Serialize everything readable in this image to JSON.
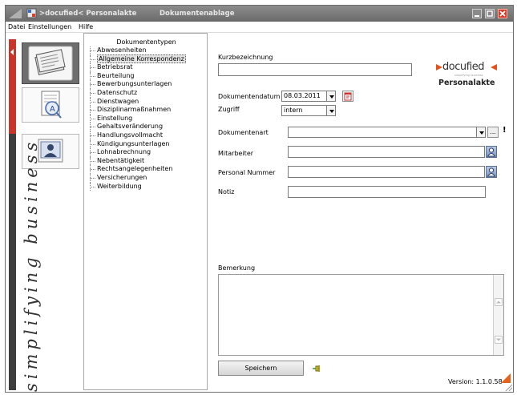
{
  "window": {
    "title": ">docufied< Personalakte",
    "subtitle": "Dokumentenablage"
  },
  "menu": [
    {
      "label": "Datei",
      "accel": "D"
    },
    {
      "label": "Einstellungen",
      "accel": "E"
    },
    {
      "label": "Hilfe",
      "accel": "H"
    }
  ],
  "left_nav": {
    "items": [
      {
        "name": "documents",
        "icon": "stack-of-documents-icon",
        "active": true
      },
      {
        "name": "search",
        "icon": "magnifier-document-icon",
        "active": false
      },
      {
        "name": "personnel",
        "icon": "person-card-icon",
        "active": false
      }
    ],
    "slogan": "simplifying business",
    "accent_color": "#c8362a"
  },
  "types_panel": {
    "header": "Dokumententypen",
    "items": [
      "Abwesenheiten",
      "Allgemeine Korrespondenz",
      "Betriebsrat",
      "Beurteilung",
      "Bewerbungsunterlagen",
      "Datenschutz",
      "Dienstwagen",
      "Disziplinarmaßnahmen",
      "Einstellung",
      "Gehaltsveränderung",
      "Handlungsvollmacht",
      "Kündigungsunterlagen",
      "Lohnabrechnung",
      "Nebentätigkeit",
      "Rechtsangelegenheiten",
      "Versicherungen",
      "Weiterbildung"
    ],
    "selected": "Allgemeine Korrespondenz"
  },
  "form": {
    "kurzbezeichnung_label": "Kurzbezeichnung",
    "kurzbezeichnung_value": "",
    "dokumentendatum_label": "Dokumentendatum",
    "dokumentendatum_value": "08.03.2011",
    "zugriff_label": "Zugriff",
    "zugriff_value": "intern",
    "dokumentenart_label": "Dokumentenart",
    "dokumentenart_value": "",
    "dokumentenart_required_mark": "!",
    "browse_button_label": "...",
    "mitarbeiter_label": "Mitarbeiter",
    "mitarbeiter_value": "",
    "personal_nummer_label": "Personal Nummer",
    "personal_nummer_value": "",
    "notiz_label": "Notiz",
    "notiz_value": "",
    "bemerkung_label": "Bemerkung",
    "bemerkung_value": "",
    "save_label": "Speichern",
    "save_accel": "S"
  },
  "logo": {
    "brand": "docufied",
    "tagline": "simplifying business",
    "product": "Personalakte",
    "brand_color": "#e5531c"
  },
  "footer": {
    "version": "Version: 1.1.0.58"
  }
}
